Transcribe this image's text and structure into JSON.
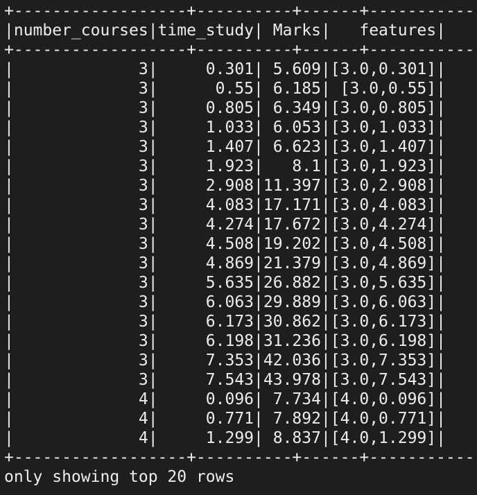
{
  "table": {
    "border": "+------------------+----------+------+------------+",
    "header": "|number_courses|time_study| Marks|   features|",
    "columns": [
      "number_courses",
      "time_study",
      "Marks",
      "features"
    ],
    "rows": [
      "|             3|     0.301| 5.609|[3.0,0.301]|",
      "|             3|      0.55| 6.185| [3.0,0.55]|",
      "|             3|     0.805| 6.349|[3.0,0.805]|",
      "|             3|     1.033| 6.053|[3.0,1.033]|",
      "|             3|     1.407| 6.623|[3.0,1.407]|",
      "|             3|     1.923|   8.1|[3.0,1.923]|",
      "|             3|     2.908|11.397|[3.0,2.908]|",
      "|             3|     4.083|17.171|[3.0,4.083]|",
      "|             3|     4.274|17.672|[3.0,4.274]|",
      "|             3|     4.508|19.202|[3.0,4.508]|",
      "|             3|     4.869|21.379|[3.0,4.869]|",
      "|             3|     5.635|26.882|[3.0,5.635]|",
      "|             3|     6.063|29.889|[3.0,6.063]|",
      "|             3|     6.173|30.862|[3.0,6.173]|",
      "|             3|     6.198|31.236|[3.0,6.198]|",
      "|             3|     7.353|42.036|[3.0,7.353]|",
      "|             3|     7.543|43.978|[3.0,7.543]|",
      "|             4|     0.096| 7.734|[4.0,0.096]|",
      "|             4|     0.771| 7.892|[4.0,0.771]|",
      "|             4|     1.299| 8.837|[4.0,1.299]|"
    ],
    "footer": "only showing top 20 rows"
  },
  "colors": {
    "background": "#1e1e1e",
    "text": "#ededed"
  }
}
